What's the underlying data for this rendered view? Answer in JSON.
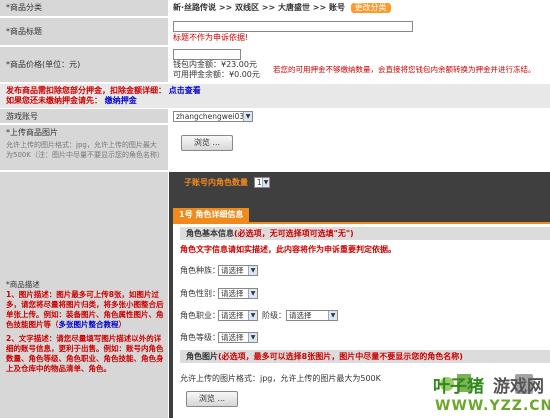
{
  "category": {
    "label": "*商品分类",
    "value": "新·丝路传说 >> 双线区 >> 大唐盛世 >> 账号",
    "change_button": "更改分类"
  },
  "title_field": {
    "label": "*商品标题",
    "value": "",
    "hint": "标题不作为申诉依据!"
  },
  "price_field": {
    "label": "*商品价格(单位：元)",
    "value": "",
    "wallet_balance": "钱包内金额：¥23.00元",
    "available_balance": "可用押金余额：¥0.00元",
    "warning": "若您的可用押金不够缴纳数量，会直接将您钱包内余额转换为押金并进行冻结。"
  },
  "notice": {
    "line1_prefix": "发布商品需扣除您部分押金，扣除金额详细：",
    "line1_link": "点击查看",
    "line2_prefix": "如果您还未缴纳押金请先：",
    "line2_link": "缴纳押金"
  },
  "game_account": {
    "label": "游戏账号",
    "selected": "zhangchengwei03"
  },
  "upload_image": {
    "label": "*上传商品图片",
    "desc": "允许上传的图片格式：jpg，允许上传的图片最大为500K（注：图片中尽量不要显示您的角色名称）",
    "browse_button": "浏览 ..."
  },
  "role_count": {
    "label": "子账号内角色数量",
    "selected": "1"
  },
  "role_tab": {
    "label": "1号 角色详细信息"
  },
  "role_basic": {
    "header_prefix": "角色基本信息",
    "header_note": "(必选项，无可选择项可选填\"无\")",
    "warning": "角色文字信息请如实描述，此内容将作为申诉重要判定依据。",
    "fields": [
      {
        "label": "角色种族：",
        "select": "请选择"
      },
      {
        "label": "角色性别：",
        "select": "请选择"
      },
      {
        "label": "角色职业：",
        "select": "请选择"
      },
      {
        "label": "角色等级：",
        "select": "请选择"
      }
    ],
    "rank_label": "阶级：",
    "rank_select": "请选择"
  },
  "role_image": {
    "header_prefix": "角色图片",
    "header_note": "(必选项，最多可以选择8张图片，图片中尽量不要显示您的角色名称)",
    "desc": "允许上传的图片格式：jpg，允许上传的图片最大为500K",
    "browse_button": "浏览 ..."
  },
  "description": {
    "label": "*商品描述",
    "para1": "1、图片描述：图片最多可上传8张，如图片过多，请您将尽量将图片归类，将多张小图整合后单张上传。例如：装备图片、角色属性图片、角色技能图片等（",
    "para1_link": "多张图片整合教程",
    "para1_end": "）",
    "para2": "2、文字描述：请您尽量填写图片描述以外的详细的账号信息，更利于出售。例如：账号内角色数量、角色等级、角色职业、角色技能、角色身上及仓库中的物品清单、角色。"
  },
  "watermark": {
    "brand": "叶子猪",
    "sub": "游戏网",
    "url": "WWW.YZZ.CN"
  },
  "colors": {
    "label_bg": "#d7d7d7",
    "accent_orange": "#f08a1c",
    "warning_red": "#cc0000",
    "link_blue": "#0000cc",
    "panel_dark": "#3f3f3f"
  }
}
